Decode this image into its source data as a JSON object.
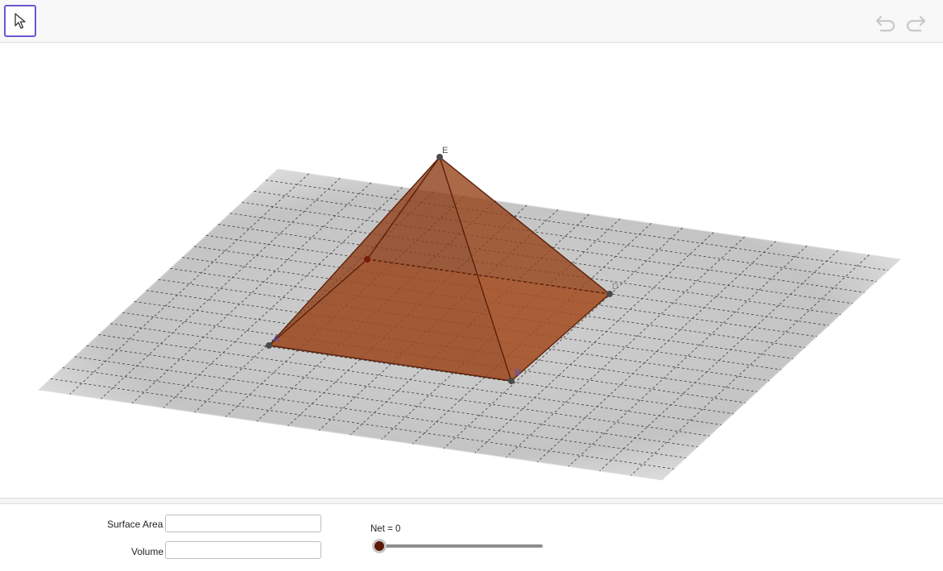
{
  "toolbar": {
    "move_tool_icon": "arrow-cursor-icon",
    "undo_icon": "undo-icon",
    "redo_icon": "redo-icon"
  },
  "graphics": {
    "points": {
      "A": "A",
      "B": "B",
      "D": "D",
      "E": "E"
    },
    "colors": {
      "pyramid_face": "#8b3a14",
      "pyramid_edge": "#5a1f08",
      "grid_plane": "#c8c8c8"
    }
  },
  "controls": {
    "surface_area_label": "Surface Area",
    "surface_area_value": "",
    "volume_label": "Volume",
    "volume_value": "",
    "net_slider": {
      "label": "Net = 0",
      "value": 0,
      "min": 0,
      "max": 1
    }
  }
}
